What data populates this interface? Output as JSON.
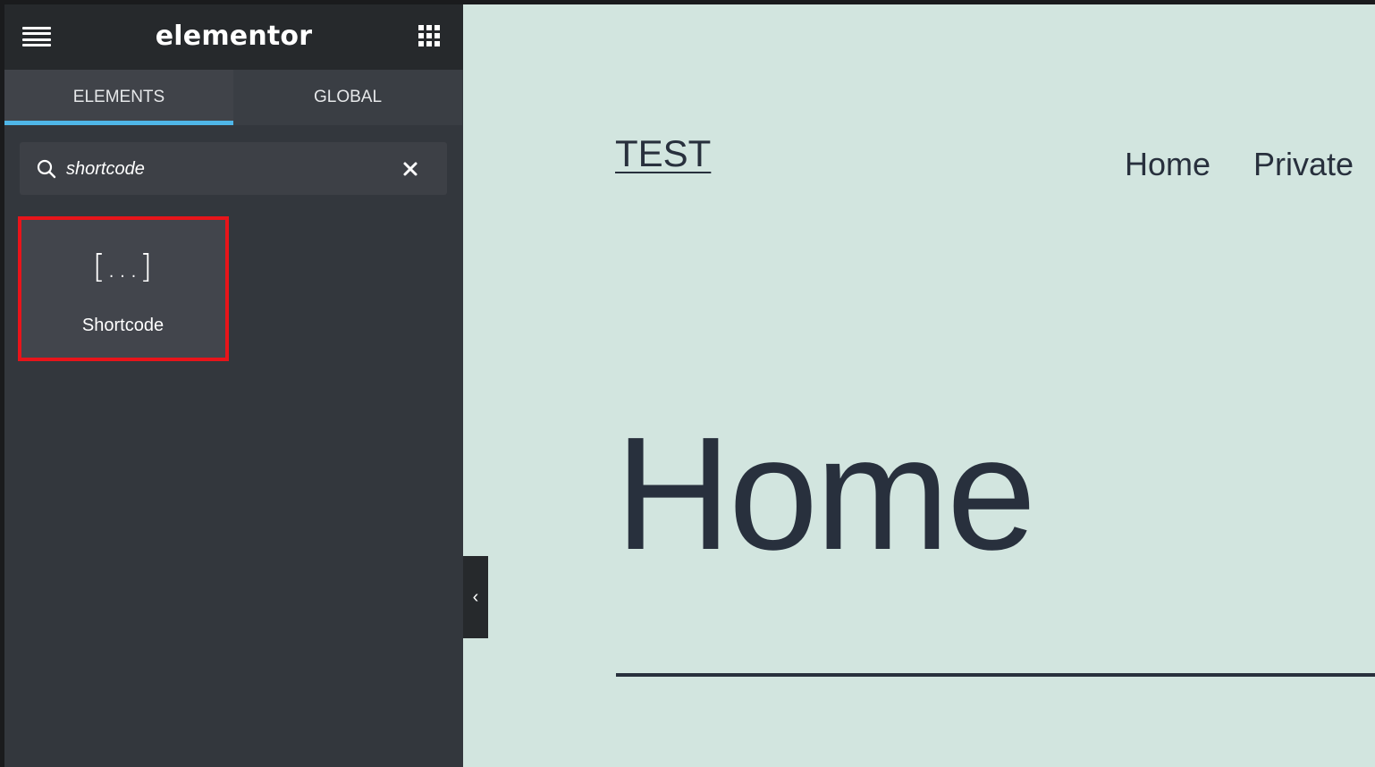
{
  "panel": {
    "logo": "elementor",
    "tabs": [
      {
        "label": "ELEMENTS",
        "active": true
      },
      {
        "label": "GLOBAL",
        "active": false
      }
    ],
    "search": {
      "value": "shortcode",
      "placeholder": "Search Widget..."
    },
    "widgets": [
      {
        "icon_text": "[...]",
        "label": "Shortcode",
        "highlighted": true
      }
    ]
  },
  "site": {
    "title": "TEST",
    "nav": [
      "Home",
      "Private"
    ],
    "page_heading": "Home"
  },
  "colors": {
    "accent": "#4fb6e8",
    "highlight": "#e8141a",
    "canvas_bg": "#d2e5df",
    "panel_bg": "#33373d",
    "text_dark": "#28303d"
  }
}
